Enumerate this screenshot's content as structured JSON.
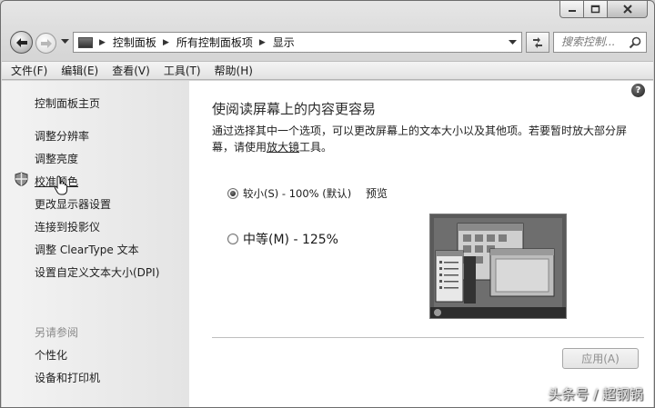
{
  "window": {
    "caption_buttons": [
      "minimize-icon",
      "maximize-icon",
      "close-icon"
    ]
  },
  "address_bar": {
    "crumbs": [
      "控制面板",
      "所有控制面板项",
      "显示"
    ],
    "search_placeholder": "搜索控制..."
  },
  "menu": {
    "items": [
      "文件(F)",
      "编辑(E)",
      "查看(V)",
      "工具(T)",
      "帮助(H)"
    ]
  },
  "sidebar": {
    "home": "控制面板主页",
    "links": [
      "调整分辨率",
      "调整亮度",
      "校准颜色",
      "更改显示器设置",
      "连接到投影仪",
      "调整 ClearType 文本",
      "设置自定义文本大小(DPI)"
    ],
    "see_also_heading": "另请参阅",
    "see_also_links": [
      "个性化",
      "设备和打印机"
    ]
  },
  "main": {
    "title": "使阅读屏幕上的内容更容易",
    "desc_before_link": "通过选择其中一个选项，可以更改屏幕上的文本大小以及其他项。若要暂时放大部分屏幕，请使用",
    "desc_link": "放大镜",
    "desc_after_link": "工具。",
    "option_small": "较小(S) - 100% (默认)",
    "option_medium": "中等(M) - 125%",
    "selected_option": "small",
    "preview_label": "预览",
    "apply_button": "应用(A)"
  },
  "watermark": "头条号 / 超钢锅"
}
